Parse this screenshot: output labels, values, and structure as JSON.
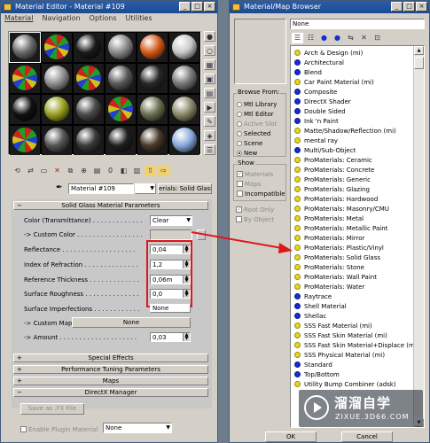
{
  "material_editor": {
    "title": "Material Editor - Material #109",
    "menu": [
      "Material",
      "Navigation",
      "Options",
      "Utilities"
    ],
    "material_name": "Material #109",
    "material_type": "erials: Solid Glass",
    "rollouts": {
      "params": "Solid Glass Material Parameters",
      "special": "Special Effects",
      "tuning": "Performance Tuning Parameters",
      "maps": "Maps",
      "directx": "DirectX Manager"
    },
    "params": {
      "color_label": "Color (Transmittance) . . . . . . . . . . . . .",
      "color_value": "Clear",
      "custom_color_label": "-> Custom Color . . . . . . . . . . . . . . . . .",
      "reflectance_label": "Reflectance . . . . . . . . . . . . . . . . . . .",
      "reflectance_value": "0,04",
      "ior_label": "Index of Refraction . . . . . . . . . . . . . .",
      "ior_value": "1,2",
      "thickness_label": "Reference Thickness . . . . . . . . . . . . .",
      "thickness_value": "0,06m",
      "roughness_label": "Surface Roughness . . . . . . . . . . . . . .",
      "roughness_value": "0,0",
      "imperfections_label": "Surface Imperfections . . . . . . . . . . . .",
      "imperfections_value": "None",
      "custom_map_label": "-> Custom Map",
      "custom_map_value": "None",
      "amount_label": "-> Amount . . . . . . . . . . . . . . . . . . . .",
      "amount_value": "0,03"
    },
    "save_fx_label": "Save as .FX File",
    "enable_plugin_label": "Enable Plugin Material",
    "plugin_value": "None"
  },
  "browser": {
    "title": "Material/Map Browser",
    "search_value": "None",
    "browse_from": {
      "title": "Browse From:",
      "options": [
        "Mtl Library",
        "Mtl Editor",
        "Active Slot",
        "Selected",
        "Scene",
        "New"
      ]
    },
    "show": {
      "title": "Show",
      "options": [
        "Materials",
        "Maps",
        "Incompatible"
      ]
    },
    "root_only": "Root Only",
    "by_object": "By Object",
    "ok_label": "OK",
    "cancel_label": "Cancel",
    "items": [
      {
        "label": "Arch & Design (mi)",
        "color": "#e6d820"
      },
      {
        "label": "Architectural",
        "color": "#1a2bd0"
      },
      {
        "label": "Blend",
        "color": "#1a2bd0"
      },
      {
        "label": "Car Paint Material (mi)",
        "color": "#e6d820"
      },
      {
        "label": "Composite",
        "color": "#1a2bd0"
      },
      {
        "label": "DirectX Shader",
        "color": "#1a2bd0"
      },
      {
        "label": "Double Sided",
        "color": "#1a2bd0"
      },
      {
        "label": "Ink 'n Paint",
        "color": "#1a2bd0"
      },
      {
        "label": "Matte/Shadow/Reflection (mi)",
        "color": "#e6d820"
      },
      {
        "label": "mental ray",
        "color": "#e6d820"
      },
      {
        "label": "Multi/Sub-Object",
        "color": "#1a2bd0"
      },
      {
        "label": "ProMaterials: Ceramic",
        "color": "#e6d820"
      },
      {
        "label": "ProMaterials: Concrete",
        "color": "#e6d820"
      },
      {
        "label": "ProMaterials: Generic",
        "color": "#e6d820"
      },
      {
        "label": "ProMaterials: Glazing",
        "color": "#e6d820"
      },
      {
        "label": "ProMaterials: Hardwood",
        "color": "#e6d820"
      },
      {
        "label": "ProMaterials: Masonry/CMU",
        "color": "#e6d820"
      },
      {
        "label": "ProMaterials: Metal",
        "color": "#e6d820"
      },
      {
        "label": "ProMaterials: Metallic Paint",
        "color": "#e6d820"
      },
      {
        "label": "ProMaterials: Mirror",
        "color": "#e6d820"
      },
      {
        "label": "ProMaterials: Plastic/Vinyl",
        "color": "#e6d820"
      },
      {
        "label": "ProMaterials: Solid Glass",
        "color": "#e6d820"
      },
      {
        "label": "ProMaterials: Stone",
        "color": "#e6d820"
      },
      {
        "label": "ProMaterials: Wall Paint",
        "color": "#e6d820"
      },
      {
        "label": "ProMaterials: Water",
        "color": "#e6d820"
      },
      {
        "label": "Raytrace",
        "color": "#1a2bd0"
      },
      {
        "label": "Shell Material",
        "color": "#1a2bd0"
      },
      {
        "label": "Shellac",
        "color": "#1a2bd0"
      },
      {
        "label": "SSS Fast Material (mi)",
        "color": "#e6d820"
      },
      {
        "label": "SSS Fast Skin Material (mi)",
        "color": "#e6d820"
      },
      {
        "label": "SSS Fast Skin Material+Displace (mi)",
        "color": "#e6d820"
      },
      {
        "label": "SSS Physical Material (mi)",
        "color": "#e6d820"
      },
      {
        "label": "Standard",
        "color": "#1a2bd0"
      },
      {
        "label": "Top/Bottom",
        "color": "#1a2bd0"
      },
      {
        "label": "Utility Bump Combiner (adsk)",
        "color": "#e6d820"
      }
    ]
  },
  "watermark": {
    "name": "溜溜自学",
    "url": "ZIXUE.3D66.COM"
  },
  "colors": {
    "highlight_red": "#e0161a",
    "title_blue": "#1b4a92"
  },
  "slot_colors": [
    "#6a6a6a",
    "rainbow",
    "#1a1a1a",
    "#8a8a8a",
    "#d45a1a",
    "#c8c8c8",
    "rainbow",
    "#909090",
    "rainbow",
    "#5a5a5a",
    "#2a2a2a",
    "#7a7a7a",
    "#101010",
    "#9aa020",
    "#4a4a4a",
    "rainbow",
    "#6a7050",
    "#8a8a6a",
    "rainbow",
    "#555555",
    "#3a3a3a",
    "#202020",
    "#4a3a2a",
    "#88aadd"
  ]
}
